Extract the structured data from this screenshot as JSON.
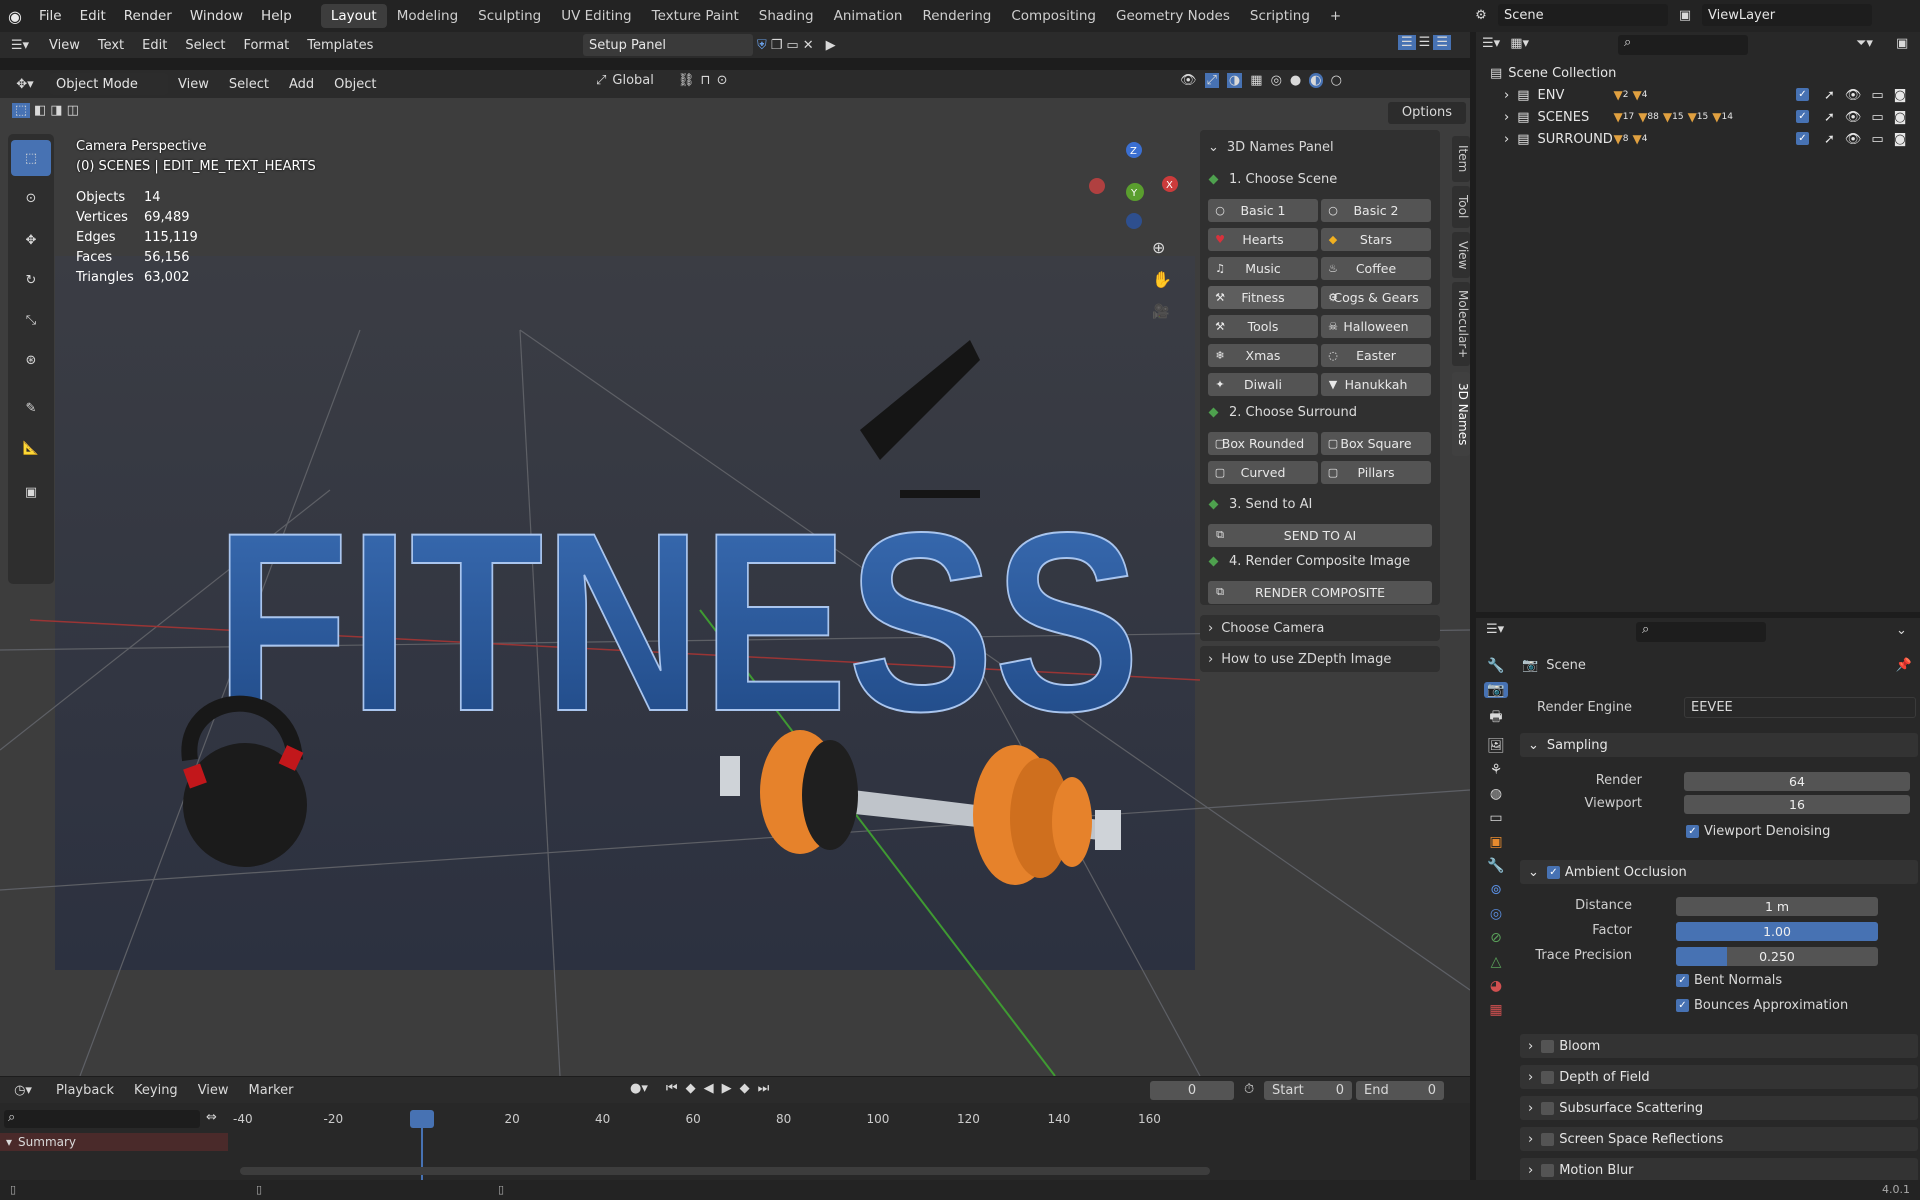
{
  "topbar": {
    "menus": [
      "File",
      "Edit",
      "Render",
      "Window",
      "Help"
    ],
    "workspaces": [
      "Layout",
      "Modeling",
      "Sculpting",
      "UV Editing",
      "Texture Paint",
      "Shading",
      "Animation",
      "Rendering",
      "Compositing",
      "Geometry Nodes",
      "Scripting"
    ],
    "scene": "Scene",
    "view_layer": "ViewLayer",
    "add_tab": "+"
  },
  "text_editor": {
    "menus": [
      "View",
      "Text",
      "Edit",
      "Select",
      "Format",
      "Templates"
    ],
    "file": "Setup Panel"
  },
  "viewport": {
    "mode": "Object Mode",
    "menus": [
      "View",
      "Select",
      "Add",
      "Object"
    ],
    "orientation": "Global",
    "options": "Options",
    "overlay_title": "Camera Perspective",
    "overlay_subtitle": "(0) SCENES | EDIT_ME_TEXT_HEARTS",
    "stats": [
      {
        "label": "Objects",
        "value": "14"
      },
      {
        "label": "Vertices",
        "value": "69,489"
      },
      {
        "label": "Edges",
        "value": "115,119"
      },
      {
        "label": "Faces",
        "value": "56,156"
      },
      {
        "label": "Triangles",
        "value": "63,002"
      }
    ],
    "scene_text": "FITNESS",
    "gizmo": {
      "x": "X",
      "y": "Y",
      "z": "Z"
    }
  },
  "npanel": {
    "title": "3D Names Panel",
    "step1": "1. Choose Scene",
    "scenes": [
      [
        "Basic 1",
        "Basic 2"
      ],
      [
        "Hearts",
        "Stars"
      ],
      [
        "Music",
        "Coffee"
      ],
      [
        "Fitness",
        "Cogs & Gears"
      ],
      [
        "Tools",
        "Halloween"
      ],
      [
        "Xmas",
        "Easter"
      ],
      [
        "Diwali",
        "Hanukkah"
      ]
    ],
    "step2": "2. Choose Surround",
    "surrounds": [
      [
        "Box Rounded",
        "Box Square"
      ],
      [
        "Curved",
        "Pillars"
      ]
    ],
    "step3": "3. Send to AI",
    "send_btn": "SEND TO AI",
    "step4": "4. Render Composite Image",
    "render_btn": "RENDER COMPOSITE",
    "choose_camera": "Choose Camera",
    "zdepth": "How to use ZDepth Image",
    "side_tabs": [
      "Item",
      "Tool",
      "View",
      "Molecular+",
      "3D Names"
    ]
  },
  "outliner": {
    "root": "Scene Collection",
    "items": [
      {
        "name": "ENV",
        "counts": [
          "2",
          "4"
        ]
      },
      {
        "name": "SCENES",
        "counts": [
          "17",
          "88",
          "15",
          "15",
          "14"
        ]
      },
      {
        "name": "SURROUND",
        "counts": [
          "8",
          "4"
        ]
      }
    ]
  },
  "properties": {
    "context": "Scene",
    "render_engine_label": "Render Engine",
    "render_engine": "EEVEE",
    "sampling": {
      "title": "Sampling",
      "render_label": "Render",
      "render": "64",
      "viewport_label": "Viewport",
      "viewport": "16",
      "denoise": "Viewport Denoising"
    },
    "ao": {
      "title": "Ambient Occlusion",
      "distance_label": "Distance",
      "distance": "1 m",
      "factor_label": "Factor",
      "factor": "1.00",
      "factor_fill": 1.0,
      "trace_label": "Trace Precision",
      "trace": "0.250",
      "trace_fill": 0.25,
      "bent": "Bent Normals",
      "bounces": "Bounces Approximation"
    },
    "sections": [
      "Bloom",
      "Depth of Field",
      "Subsurface Scattering",
      "Screen Space Reflections",
      "Motion Blur"
    ]
  },
  "timeline": {
    "menus": [
      "Playback",
      "Keying",
      "View",
      "Marker"
    ],
    "current": "0",
    "start_label": "Start",
    "start": "0",
    "end_label": "End",
    "end": "0",
    "ticks": [
      "-40",
      "-20",
      "0",
      "20",
      "40",
      "60",
      "80",
      "100",
      "120",
      "140",
      "160"
    ],
    "summary": "Summary"
  },
  "status": {
    "version": "4.0.1"
  }
}
